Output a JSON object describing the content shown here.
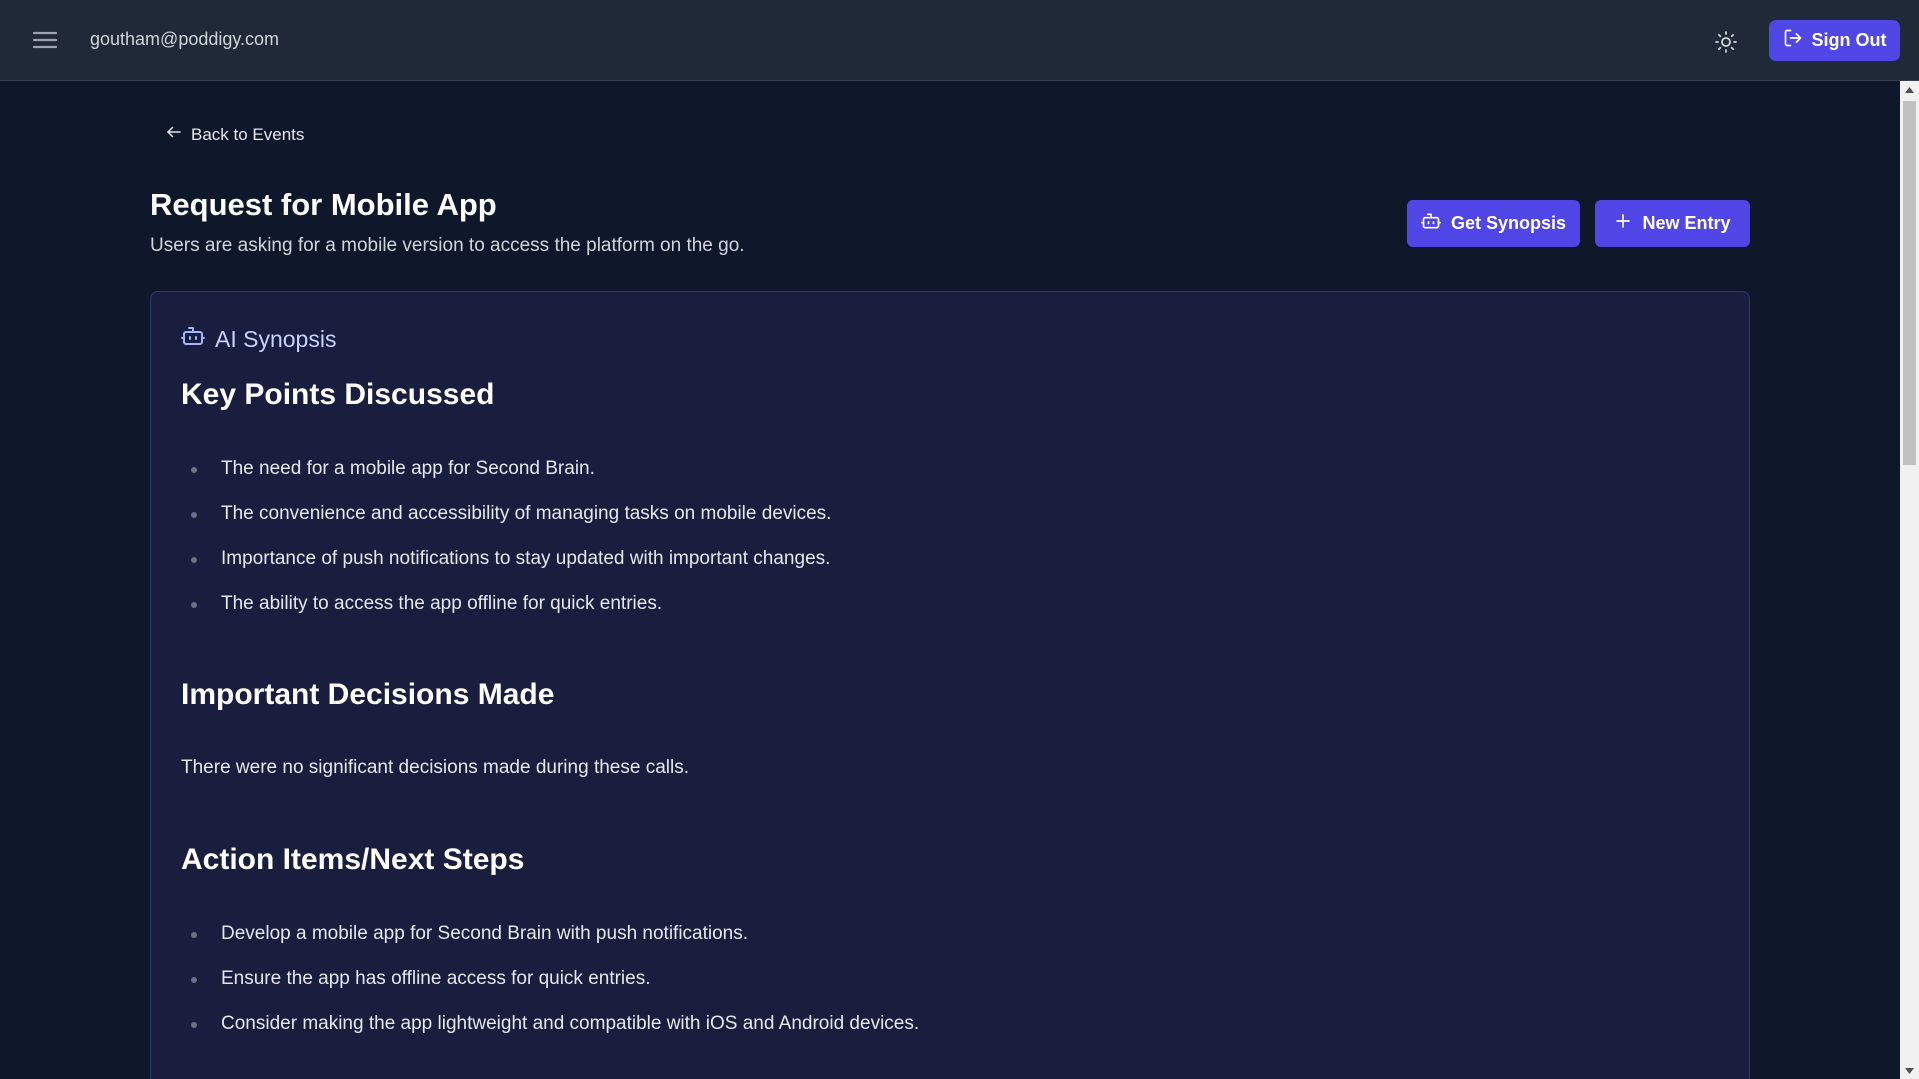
{
  "header": {
    "user_email": "goutham@poddigy.com",
    "sign_out_label": "Sign Out",
    "menu_icon": "hamburger-menu-icon",
    "theme_icon": "sun-icon"
  },
  "page": {
    "back_label": "Back to Events",
    "title": "Request for Mobile App",
    "subtitle": "Users are asking for a mobile version to access the platform on the go.",
    "get_synopsis_label": "Get Synopsis",
    "new_entry_label": "New Entry"
  },
  "synopsis": {
    "header_label": "AI Synopsis",
    "sections": [
      {
        "heading": "Key Points Discussed",
        "items": [
          "The need for a mobile app for Second Brain.",
          "The convenience and accessibility of managing tasks on mobile devices.",
          "Importance of push notifications to stay updated with important changes.",
          "The ability to access the app offline for quick entries."
        ]
      },
      {
        "heading": "Important Decisions Made",
        "text": "There were no significant decisions made during these calls."
      },
      {
        "heading": "Action Items/Next Steps",
        "items": [
          "Develop a mobile app for Second Brain with push notifications.",
          "Ensure the app has offline access for quick entries.",
          "Consider making the app lightweight and compatible with iOS and Android devices."
        ]
      }
    ]
  },
  "colors": {
    "accent": "#4f46e5",
    "topbar_bg": "#1f2937",
    "page_bg": "#0f172a",
    "card_bg": "#191d3e"
  }
}
